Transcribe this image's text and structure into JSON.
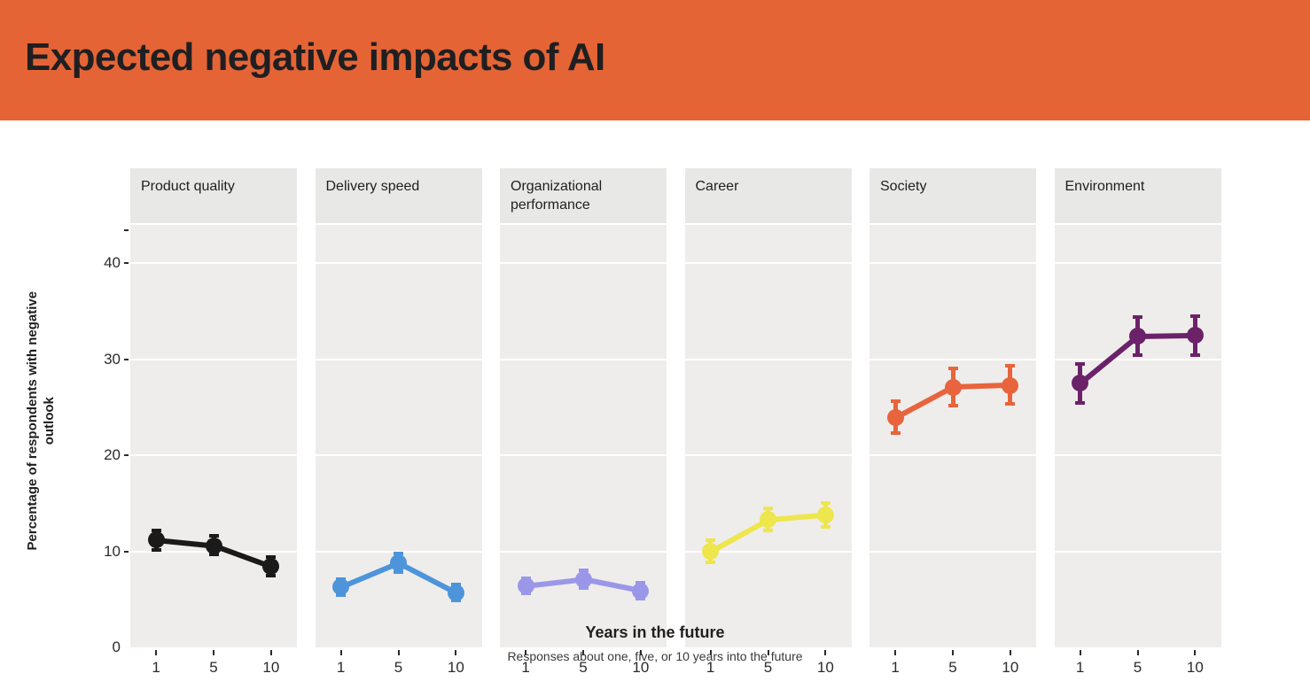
{
  "header": {
    "title": "Expected negative impacts of AI",
    "background_color": "#e56436"
  },
  "chart_data": {
    "type": "line",
    "title": "Expected negative impacts of AI",
    "xlabel": "Years in the future",
    "xlabel_note": "Responses about one, five, or 10 years into the future",
    "ylabel": "Percentage of respondents with negative outlook",
    "x": [
      1,
      5,
      10
    ],
    "xtick_labels": [
      "1",
      "5",
      "10"
    ],
    "ytick_labels": [
      "0",
      "10",
      "20",
      "30",
      "40"
    ],
    "ytick_values": [
      0,
      10,
      20,
      30,
      40
    ],
    "ylim": [
      0,
      44
    ],
    "grid": true,
    "legend_position": "none",
    "facet_layout": "1x6",
    "panel_background": "#eeedeb",
    "strip_background": "#e8e8e6",
    "gridline_color": "#ffffff",
    "error_bars": "95% interval",
    "series": [
      {
        "name": "Product quality",
        "color": "#1a1a1a",
        "values": [
          11.2,
          10.6,
          8.4
        ],
        "err_low": [
          10.0,
          9.5,
          7.3
        ],
        "err_high": [
          12.4,
          11.8,
          9.6
        ]
      },
      {
        "name": "Delivery speed",
        "color": "#4d94db",
        "values": [
          6.3,
          8.8,
          5.7
        ],
        "err_low": [
          5.3,
          7.7,
          4.7
        ],
        "err_high": [
          7.3,
          10.0,
          6.7
        ]
      },
      {
        "name": "Organizational performance",
        "color": "#9b97e8",
        "values": [
          6.4,
          7.1,
          5.9
        ],
        "err_low": [
          5.4,
          6.0,
          4.9
        ],
        "err_high": [
          7.4,
          8.2,
          6.9
        ]
      },
      {
        "name": "Career",
        "color": "#eee64d",
        "values": [
          10.0,
          13.3,
          13.8
        ],
        "err_low": [
          8.7,
          12.0,
          12.4
        ],
        "err_high": [
          11.3,
          14.7,
          15.2
        ]
      },
      {
        "name": "Society",
        "color": "#e8643c",
        "values": [
          23.9,
          27.1,
          27.3
        ],
        "err_low": [
          22.1,
          25.0,
          25.2
        ],
        "err_high": [
          25.8,
          29.2,
          29.5
        ]
      },
      {
        "name": "Environment",
        "color": "#6b2269",
        "values": [
          27.5,
          32.4,
          32.5
        ],
        "err_low": [
          25.3,
          30.3,
          30.3
        ],
        "err_high": [
          29.7,
          34.6,
          34.7
        ]
      }
    ]
  }
}
